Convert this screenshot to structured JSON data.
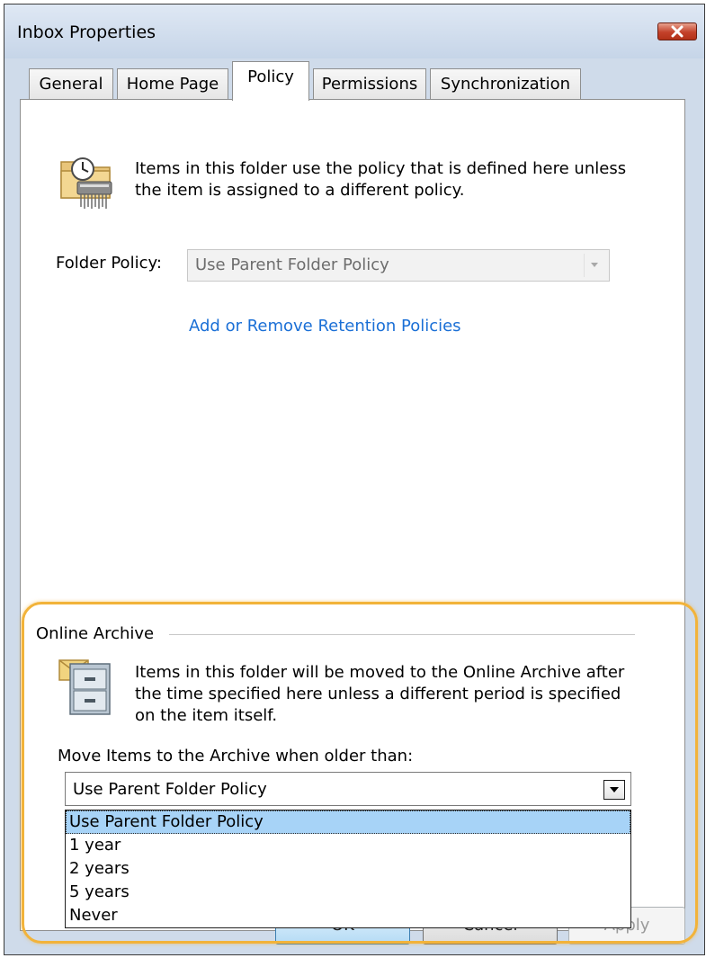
{
  "window": {
    "title": "Inbox Properties"
  },
  "tabs": [
    {
      "label": "General"
    },
    {
      "label": "Home Page"
    },
    {
      "label": "Policy"
    },
    {
      "label": "Permissions"
    },
    {
      "label": "Synchronization"
    }
  ],
  "policy": {
    "intro_text": "Items in this folder use the policy that is defined here unless the item is assigned to a different policy.",
    "folder_policy_label": "Folder Policy:",
    "folder_policy_value": "Use Parent Folder Policy",
    "retention_link": "Add or Remove Retention Policies"
  },
  "archive": {
    "group_label": "Online Archive",
    "description": "Items in this folder will be moved to the Online Archive after the time specified here unless a different period is specified on the item itself.",
    "move_label": "Move Items to the Archive when older than:",
    "selected_value": "Use Parent Folder Policy",
    "options": [
      {
        "label": "Use Parent Folder Policy"
      },
      {
        "label": "1 year"
      },
      {
        "label": "2 years"
      },
      {
        "label": "5 years"
      },
      {
        "label": "Never"
      }
    ]
  },
  "buttons": {
    "ok": "OK",
    "cancel": "Cancel",
    "apply": "Apply"
  },
  "colors": {
    "highlight": "#f2b33a",
    "link": "#1a6fd6",
    "selection": "#a7d3f7",
    "close": "#c3412a"
  },
  "icons": {
    "close": "close-icon",
    "policy": "policy-folder-icon",
    "archive": "archive-cabinet-icon"
  }
}
